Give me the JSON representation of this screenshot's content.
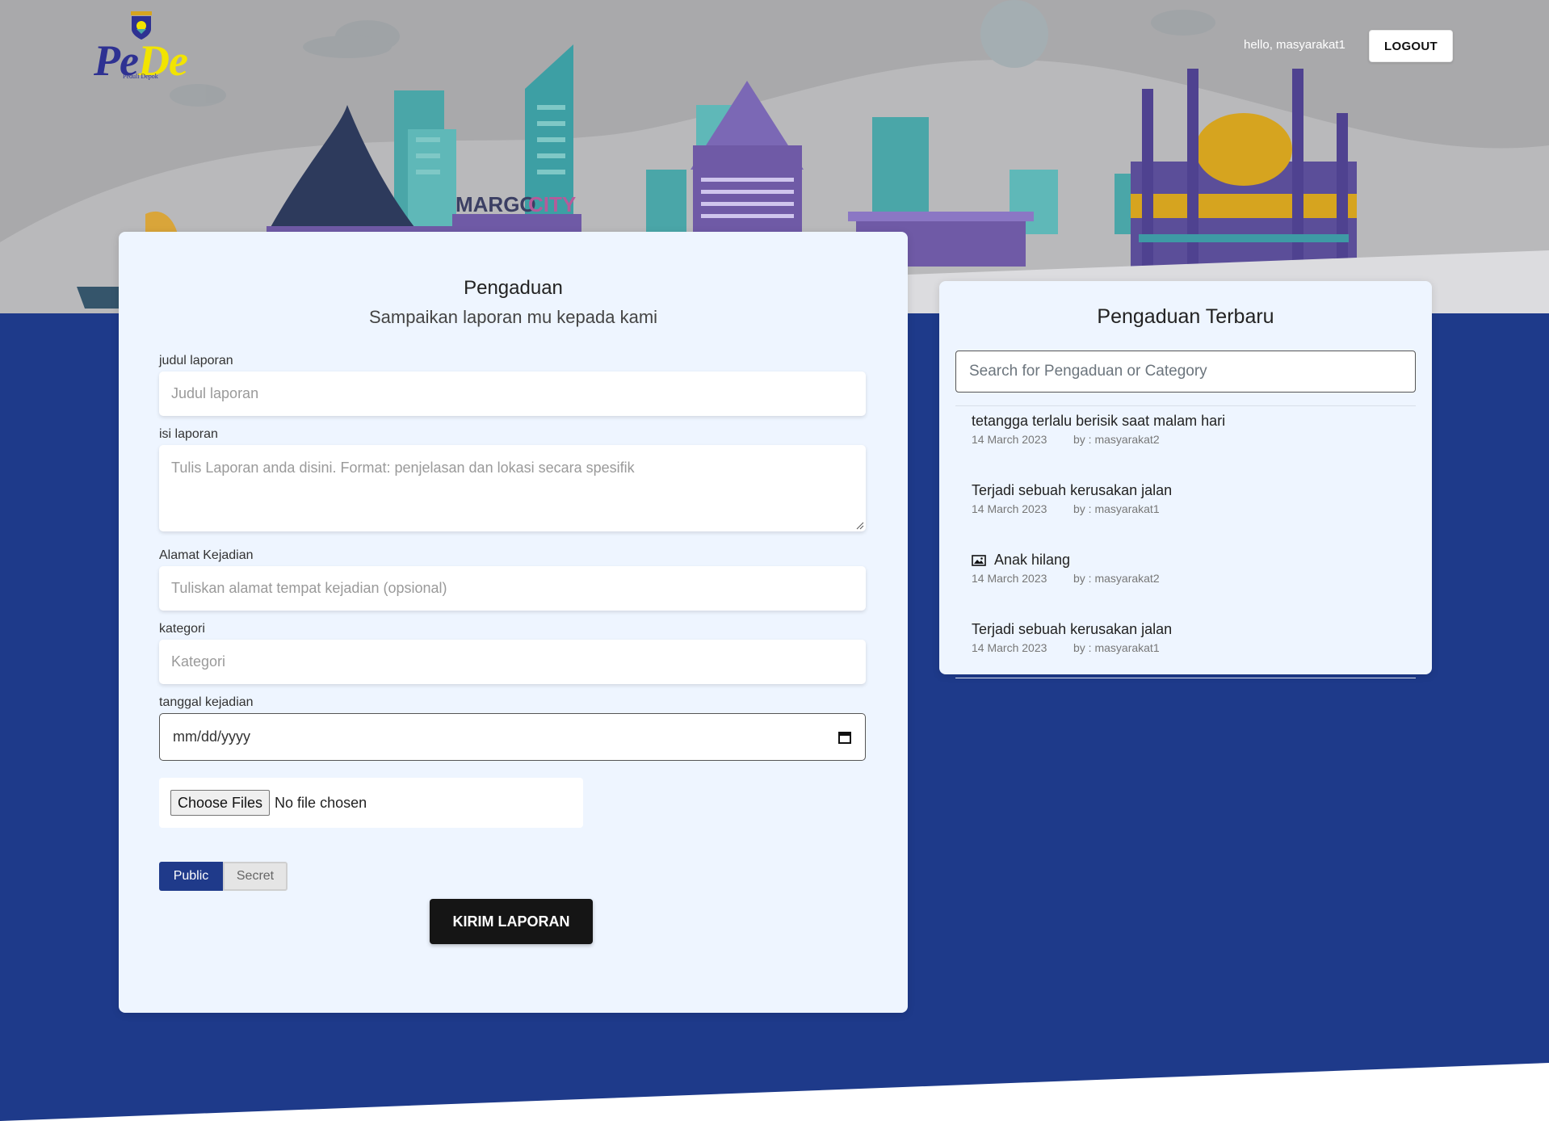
{
  "header": {
    "logo_text_1": "Pe",
    "logo_text_2": "De",
    "logo_subtitle": "Peduli Depok",
    "greeting": "hello, masyarakat1",
    "logout_label": "LOGOUT"
  },
  "banner": {
    "sign_text_1": "MARGO",
    "sign_text_2": "CITY"
  },
  "form": {
    "title": "Pengaduan",
    "subtitle": "Sampaikan laporan mu kepada kami",
    "judul_label": "judul laporan",
    "judul_placeholder": "Judul laporan",
    "isi_label": "isi laporan",
    "isi_placeholder": "Tulis Laporan anda disini. Format: penjelasan dan lokasi secara spesifik",
    "alamat_label": "Alamat Kejadian",
    "alamat_placeholder": "Tuliskan alamat tempat kejadian (opsional)",
    "kategori_label": "kategori",
    "kategori_placeholder": "Kategori",
    "tanggal_label": "tanggal kejadian",
    "tanggal_value": "mm/dd/yyyy",
    "file_button": "Choose Files",
    "file_status": "No file chosen",
    "visibility_public": "Public",
    "visibility_secret": "Secret",
    "visibility_selected": "Public",
    "submit_label": "KIRIM LAPORAN"
  },
  "recent": {
    "title": "Pengaduan Terbaru",
    "search_placeholder": "Search for Pengaduan or Category",
    "items": [
      {
        "title": "tetangga terlalu berisik saat malam hari",
        "date": "14 March 2023",
        "by": "by : masyarakat2",
        "has_image": false
      },
      {
        "title": "Terjadi sebuah kerusakan jalan",
        "date": "14 March 2023",
        "by": "by : masyarakat1",
        "has_image": false
      },
      {
        "title": "Anak hilang",
        "date": "14 March 2023",
        "by": "by : masyarakat2",
        "has_image": true
      },
      {
        "title": "Terjadi sebuah kerusakan jalan",
        "date": "14 March 2023",
        "by": "by : masyarakat1",
        "has_image": false
      }
    ]
  },
  "colors": {
    "primary_blue": "#1f3a8a",
    "hero_gray": "#a9a9ab",
    "card_bg": "#eef5ff",
    "button_dark": "#151515"
  }
}
